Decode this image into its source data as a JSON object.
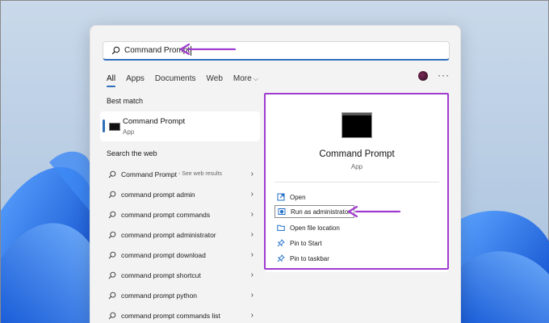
{
  "search": {
    "query": "Command Prompt"
  },
  "tabs": [
    {
      "label": "All"
    },
    {
      "label": "Apps"
    },
    {
      "label": "Documents"
    },
    {
      "label": "Web"
    },
    {
      "label": "More"
    }
  ],
  "left": {
    "best_match_heading": "Best match",
    "best_match": {
      "name": "Command Prompt",
      "type": "App"
    },
    "web_heading": "Search the web",
    "web_results": [
      {
        "text": "Command Prompt",
        "suffix": "- See web results"
      },
      {
        "text": "command prompt admin"
      },
      {
        "text": "command prompt commands"
      },
      {
        "text": "command prompt administrator"
      },
      {
        "text": "command prompt download"
      },
      {
        "text": "command prompt shortcut"
      },
      {
        "text": "command prompt python"
      },
      {
        "text": "command prompt commands list"
      }
    ]
  },
  "right": {
    "app_name": "Command Prompt",
    "app_type": "App",
    "actions": [
      {
        "label": "Open",
        "icon": "open-icon"
      },
      {
        "label": "Run as administrator",
        "icon": "shield-icon"
      },
      {
        "label": "Open file location",
        "icon": "folder-icon"
      },
      {
        "label": "Pin to Start",
        "icon": "pin-icon"
      },
      {
        "label": "Pin to taskbar",
        "icon": "pin-icon"
      }
    ]
  },
  "colors": {
    "accent": "#2f6fba",
    "highlight": "#a03bd0"
  }
}
